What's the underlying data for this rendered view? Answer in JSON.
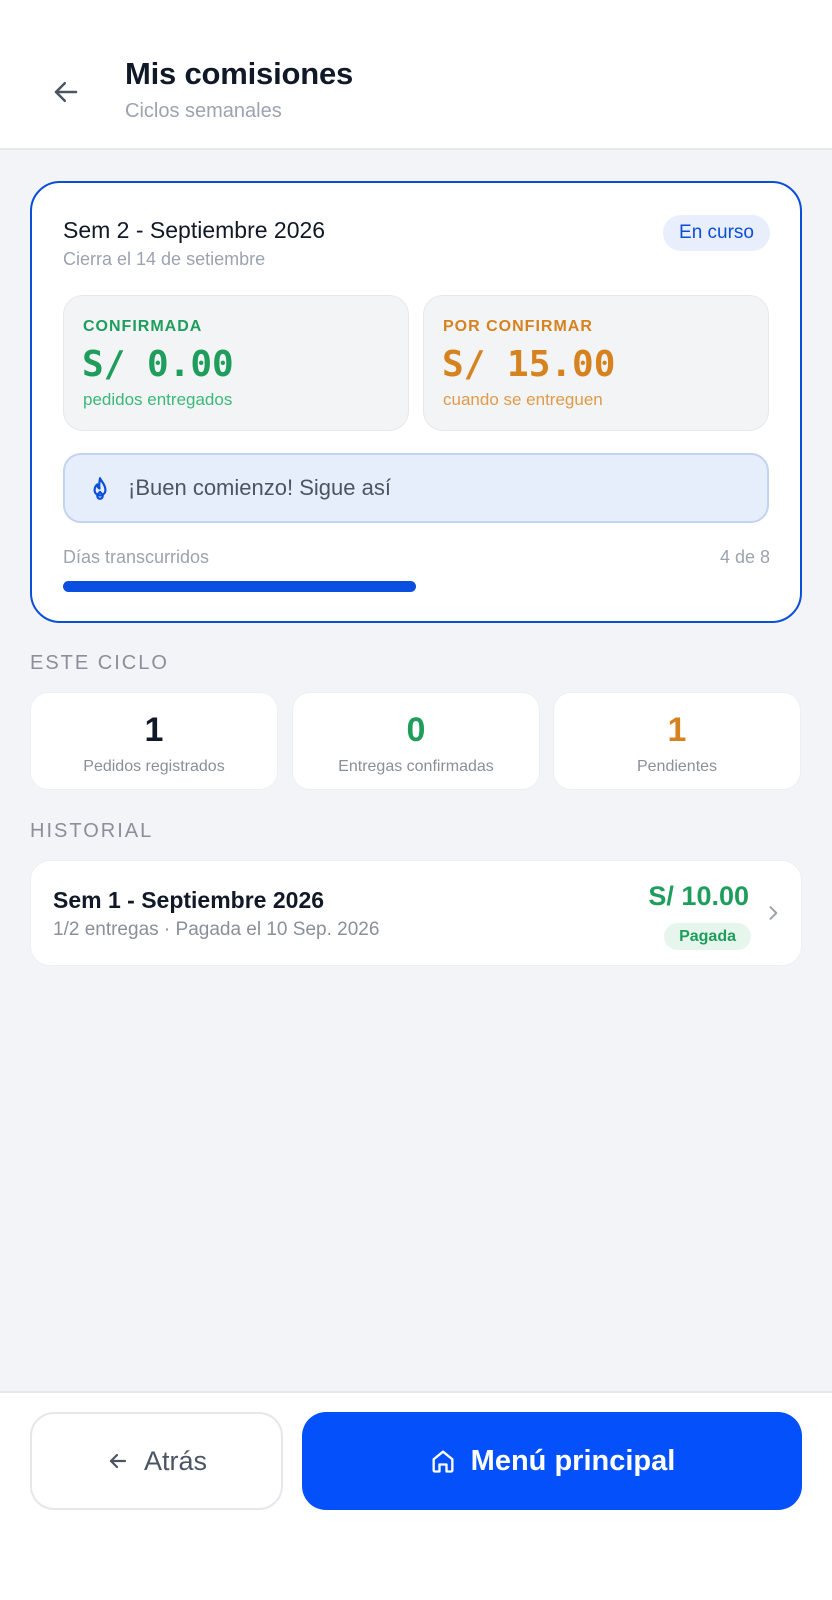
{
  "header": {
    "title": "Mis comisiones",
    "subtitle": "Ciclos semanales",
    "back_icon": "arrow-left-icon"
  },
  "current_cycle": {
    "title": "Sem 2 - Septiembre 2026",
    "closes": "Cierra el 14 de setiembre",
    "status": "En curso",
    "confirmed": {
      "label": "CONFIRMADA",
      "amount": "S/ 0.00",
      "note": "pedidos entregados"
    },
    "pending": {
      "label": "POR CONFIRMAR",
      "amount": "S/ 15.00",
      "note": "cuando se entreguen"
    },
    "motivation": {
      "icon": "flame-icon",
      "message": "¡Buen comienzo! Sigue así"
    },
    "progress": {
      "label": "Días transcurridos",
      "count_text": "4 de 8",
      "value": 4,
      "total": 8
    }
  },
  "this_cycle": {
    "section_title": "ESTE CICLO",
    "metrics": [
      {
        "value": "1",
        "label": "Pedidos registrados",
        "color": "#111827"
      },
      {
        "value": "0",
        "label": "Entregas confirmadas",
        "color": "#1f9d5c"
      },
      {
        "value": "1",
        "label": "Pendientes",
        "color": "#d6821f"
      }
    ]
  },
  "history": {
    "section_title": "HISTORIAL",
    "items": [
      {
        "title": "Sem 1 - Septiembre 2026",
        "subtitle": "1/2 entregas · Pagada el 10 Sep. 2026",
        "amount": "S/ 10.00",
        "badge": "Pagada",
        "icon": "chevron-right-icon"
      }
    ]
  },
  "footer": {
    "back_label": "Atrás",
    "back_icon": "arrow-left-icon",
    "home_label": "Menú principal",
    "home_icon": "home-icon"
  },
  "colors": {
    "accent": "#0451fb",
    "success": "#1f9d5c",
    "warning": "#d6821f"
  }
}
